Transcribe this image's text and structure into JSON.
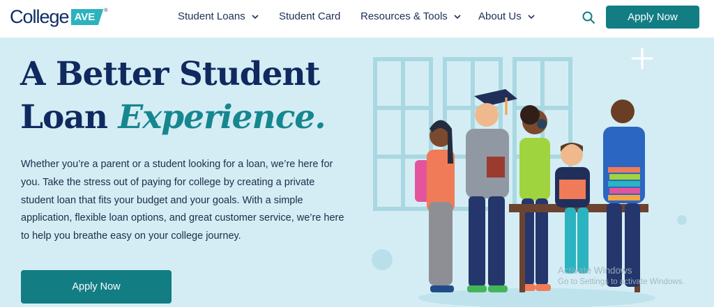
{
  "brand": {
    "logo_text": "College",
    "logo_badge": "AVE",
    "logo_mark": "®"
  },
  "nav": {
    "items": [
      {
        "label": "Student Loans",
        "has_dropdown": true
      },
      {
        "label": "Student Card",
        "has_dropdown": false
      },
      {
        "label": "Resources & Tools",
        "has_dropdown": true
      },
      {
        "label": "About Us",
        "has_dropdown": true
      }
    ],
    "search_icon": "search-icon",
    "apply_label": "Apply Now"
  },
  "hero": {
    "title_line1": "A Better Student",
    "title_line2_plain": "Loan ",
    "title_line2_accent": "Experience.",
    "description": "Whether you’re a parent or a student looking for a loan, we’re here for you. Take the stress out of paying for college by creating a private student loan that fits your budget and your goals. With a simple application, flexible loan options, and great customer service, we’re here to help you breathe easy on your college journey.",
    "cta_label": "Apply Now"
  },
  "watermark": {
    "line1": "Activate Windows",
    "line2": "Go to Settings to activate Windows."
  },
  "colors": {
    "primary_teal": "#127e84",
    "navy": "#10295f",
    "hero_bg": "#d4ecf3",
    "accent_text": "#17878f"
  }
}
